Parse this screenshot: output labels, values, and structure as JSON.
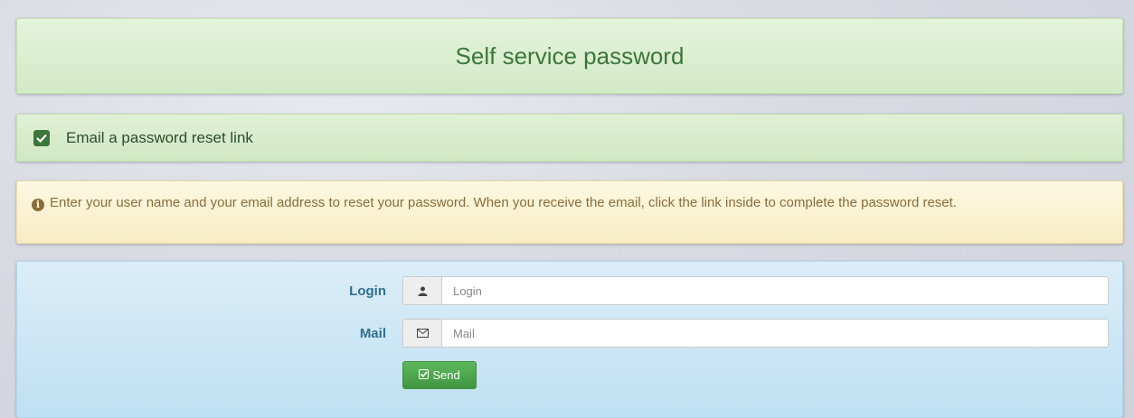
{
  "header": {
    "title": "Self service password"
  },
  "option": {
    "label": "Email a password reset link",
    "icon": "check-square-icon"
  },
  "info": {
    "icon": "info-circle-icon",
    "text": "Enter your user name and your email address to reset your password. When you receive the email, click the link inside to complete the password reset."
  },
  "form": {
    "login": {
      "label": "Login",
      "placeholder": "Login",
      "value": "",
      "icon": "user-icon"
    },
    "mail": {
      "label": "Mail",
      "placeholder": "Mail",
      "value": "",
      "icon": "envelope-icon"
    },
    "send_label": "Send",
    "send_icon": "check-square-icon"
  },
  "colors": {
    "success_text": "#3c763d",
    "warning_text": "#8a6d3b",
    "info_label": "#31708f",
    "button": "#5cb85c"
  }
}
